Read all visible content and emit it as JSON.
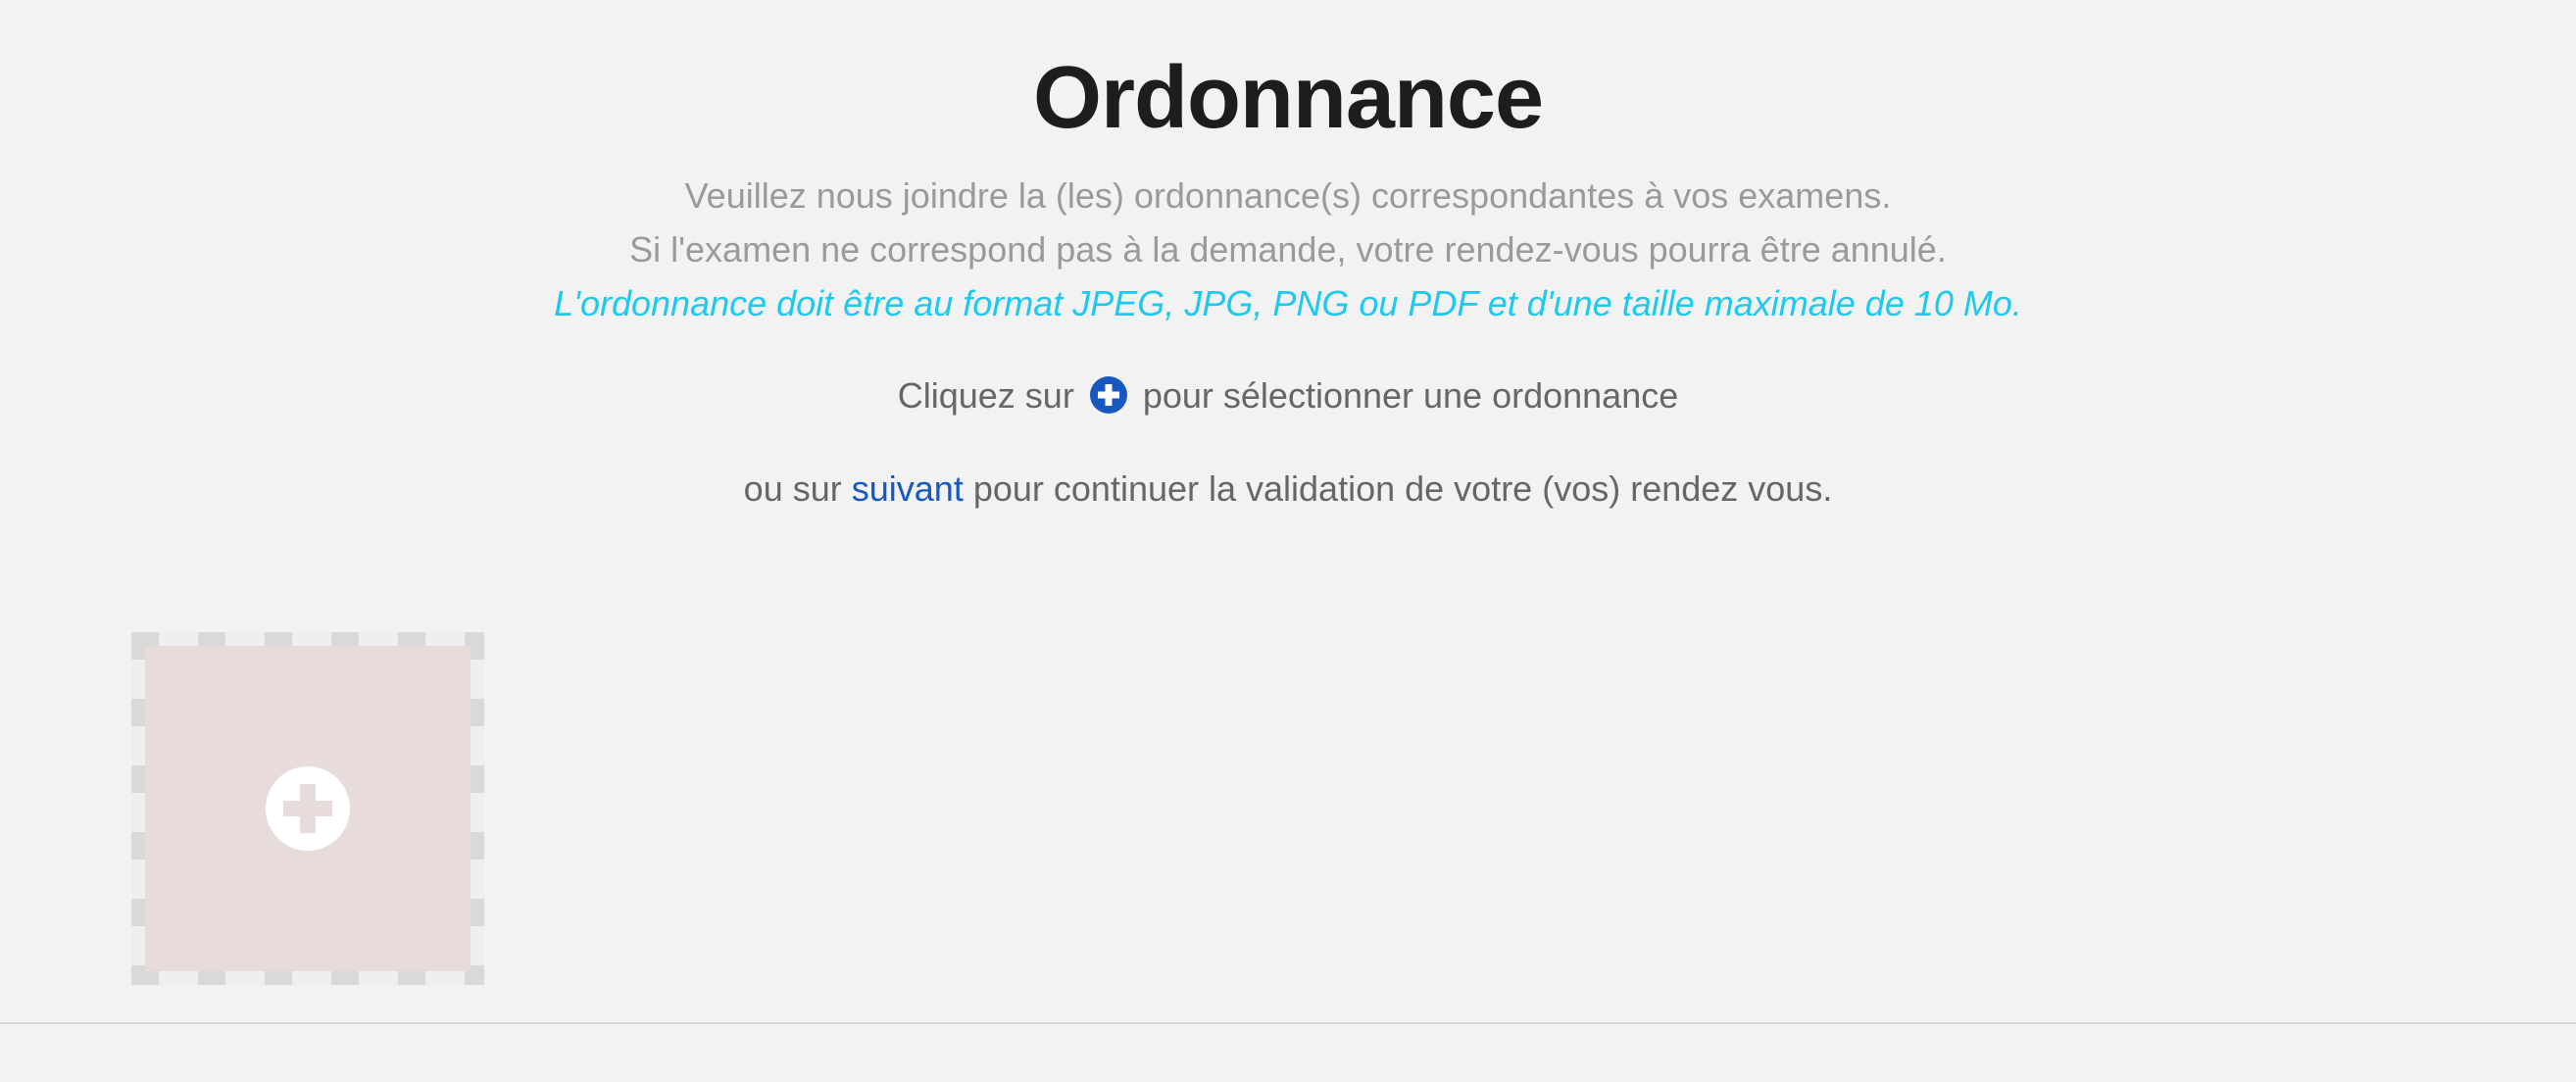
{
  "page": {
    "title": "Ordonnance"
  },
  "intro": {
    "line1": "Veuillez nous joindre la (les) ordonnance(s) correspondantes à vos examens.",
    "line2": "Si l'examen ne correspond pas à la demande, votre rendez-vous pourra être annulé.",
    "format_note": "L'ordonnance doit être au format JPEG, JPG, PNG ou PDF et d'une taille maximale de 10 Mo."
  },
  "instructions": {
    "click_prefix": "Cliquez sur",
    "click_icon": "plus-circle-icon",
    "click_suffix": "pour sélectionner une ordonnance",
    "next_prefix": "ou sur",
    "next_link": "suivant",
    "next_suffix": "pour continuer la validation de votre (vos) rendez vous."
  },
  "upload": {
    "icon": "plus-circle-icon"
  },
  "colors": {
    "background": "#f2f2f2",
    "title": "#1d1d1d",
    "muted_text": "#9a9a9a",
    "accent_cyan": "#1ec8ee",
    "brand_blue": "#1558c0",
    "upload_fill": "#e8dcda"
  }
}
